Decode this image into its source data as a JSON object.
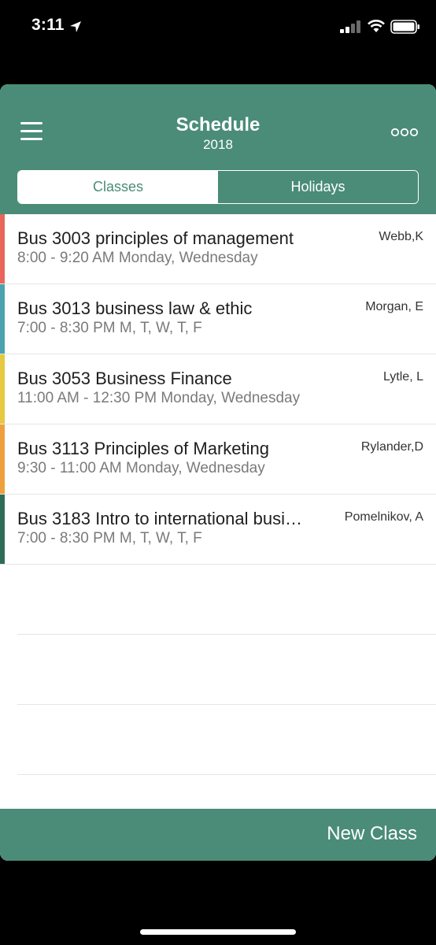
{
  "status_bar": {
    "time": "3:11"
  },
  "header": {
    "title": "Schedule",
    "subtitle": "2018",
    "tabs": [
      {
        "label": "Classes",
        "active": true
      },
      {
        "label": "Holidays",
        "active": false
      }
    ]
  },
  "classes": [
    {
      "course": "Bus 3003 principles of management",
      "time": "8:00 - 9:20 AM Monday, Wednesday",
      "instructor": "Webb,K",
      "color": "#e8675a"
    },
    {
      "course": "Bus 3013 business law & ethic",
      "time": "7:00 - 8:30 PM M, T, W, T, F",
      "instructor": "Morgan, E",
      "color": "#4aa3ad"
    },
    {
      "course": "Bus 3053 Business Finance",
      "time": "11:00 AM - 12:30 PM Monday, Wednesday",
      "instructor": "Lytle, L",
      "color": "#e6c940"
    },
    {
      "course": "Bus 3113 Principles of Marketing",
      "time": "9:30 - 11:00 AM Monday, Wednesday",
      "instructor": "Rylander,D",
      "color": "#eea03c"
    },
    {
      "course": "Bus 3183 Intro to international busi…",
      "time": "7:00 - 8:30 PM M, T, W, T, F",
      "instructor": "Pomelnikov, A",
      "color": "#2f6b56"
    }
  ],
  "footer": {
    "new_class_label": "New Class"
  },
  "colors": {
    "brand": "#4a8c77"
  }
}
